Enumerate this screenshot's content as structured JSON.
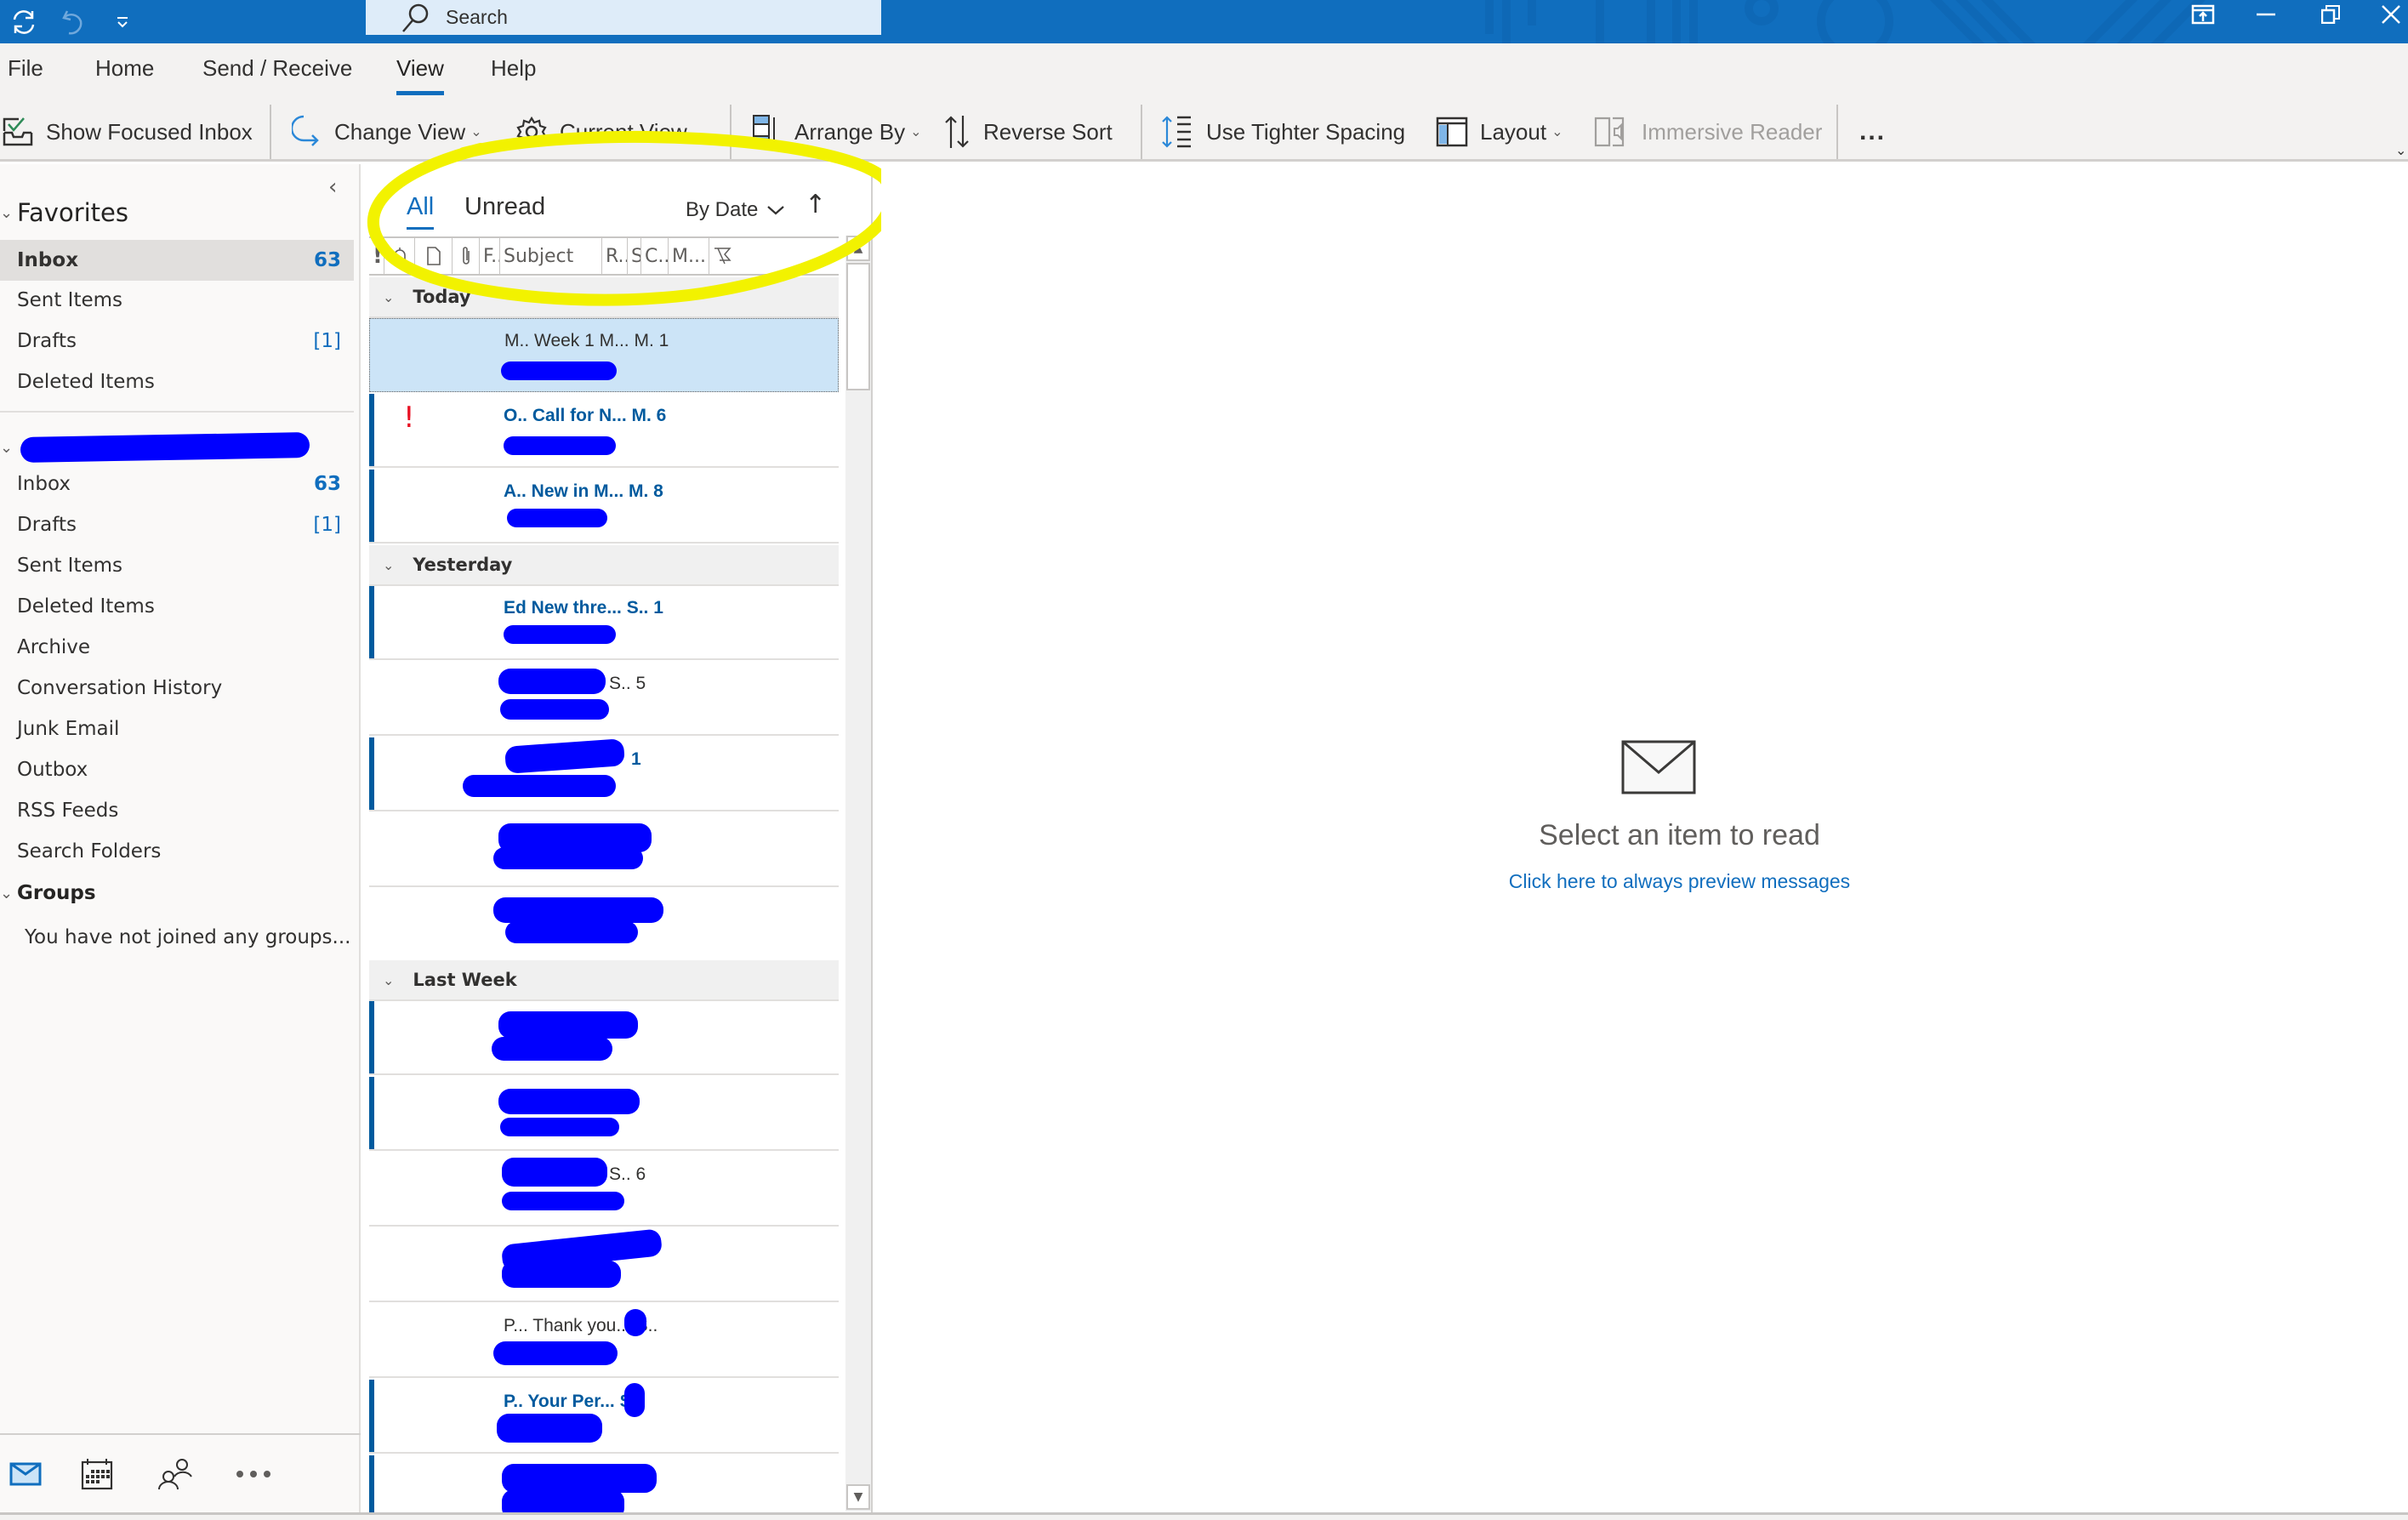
{
  "titlebar": {
    "search_placeholder": "Search",
    "icons": [
      "sync-icon",
      "undo-icon",
      "customize-quick-access-icon"
    ],
    "window_buttons": [
      "coming-soon-icon",
      "minimize-icon",
      "restore-icon",
      "close-icon"
    ]
  },
  "menu": {
    "tabs": [
      {
        "label": "File"
      },
      {
        "label": "Home"
      },
      {
        "label": "Send / Receive"
      },
      {
        "label": "View",
        "active": true
      },
      {
        "label": "Help"
      }
    ]
  },
  "ribbon": {
    "show_focused_inbox": "Show Focused Inbox",
    "change_view": "Change View",
    "current_view": "Current View",
    "arrange_by": "Arrange By",
    "reverse_sort": "Reverse Sort",
    "tighter_spacing": "Use Tighter Spacing",
    "layout": "Layout",
    "immersive_reader": "Immersive Reader",
    "more": "..."
  },
  "folders": {
    "favorites_label": "Favorites",
    "favorites": [
      {
        "name": "Inbox",
        "count": "63",
        "selected": true
      },
      {
        "name": "Sent Items",
        "count": ""
      },
      {
        "name": "Drafts",
        "count": "[1]"
      },
      {
        "name": "Deleted Items",
        "count": ""
      }
    ],
    "account": [
      {
        "name": "Inbox",
        "count": "63"
      },
      {
        "name": "Drafts",
        "count": "[1]"
      },
      {
        "name": "Sent Items",
        "count": ""
      },
      {
        "name": "Deleted Items",
        "count": ""
      },
      {
        "name": "Archive",
        "count": ""
      },
      {
        "name": "Conversation History",
        "count": ""
      },
      {
        "name": "Junk Email",
        "count": ""
      },
      {
        "name": "Outbox",
        "count": ""
      },
      {
        "name": "RSS Feeds",
        "count": ""
      },
      {
        "name": "Search Folders",
        "count": ""
      }
    ],
    "groups_label": "Groups",
    "groups_note": "You have not joined any groups..."
  },
  "navbar": [
    "mail-icon",
    "calendar-icon",
    "people-icon",
    "more-icon"
  ],
  "message_list": {
    "filter_all": "All",
    "filter_unread": "Unread",
    "sort_by": "By Date",
    "sort_direction": "↑",
    "columns": [
      "!",
      "reminder",
      "icon",
      "attachment",
      "F..",
      "Subject",
      "R..",
      "S",
      "C..",
      "M...",
      "flag"
    ],
    "groups": [
      {
        "label": "Today",
        "messages": [
          {
            "text": "M.. Week 1 M...   M. 1",
            "unread": false,
            "selected": true,
            "important": false
          },
          {
            "text": "O.. Call for N...   M. 6",
            "unread": true,
            "selected": false,
            "important": true
          },
          {
            "text": "A.. New in M...   M. 8",
            "unread": true,
            "selected": false,
            "important": false
          }
        ]
      },
      {
        "label": "Yesterday",
        "messages": [
          {
            "text": "Ed New thre...   S.. 1",
            "unread": true
          },
          {
            "text": "S.. 5",
            "unread": false
          },
          {
            "text": "1",
            "unread": true
          },
          {
            "text": "",
            "unread": false
          },
          {
            "text": "",
            "unread": false
          }
        ]
      },
      {
        "label": "Last Week",
        "messages": [
          {
            "text": "",
            "unread": true
          },
          {
            "text": "",
            "unread": true
          },
          {
            "text": "S.. 6",
            "unread": false
          },
          {
            "text": "",
            "unread": false
          },
          {
            "text": "P... Thank you...   S..",
            "unread": false
          },
          {
            "text": "P.. Your Per...   S..",
            "unread": true
          },
          {
            "text": "",
            "unread": true
          }
        ]
      }
    ]
  },
  "reading_pane": {
    "title": "Select an item to read",
    "link": "Click here to always preview messages"
  },
  "colors": {
    "accent": "#106ebe",
    "unread_bar": "#005a9e",
    "selected_row": "#cce4f7",
    "importance": "#e81123",
    "annotation": "#f2f200",
    "redaction": "#0000ff"
  }
}
